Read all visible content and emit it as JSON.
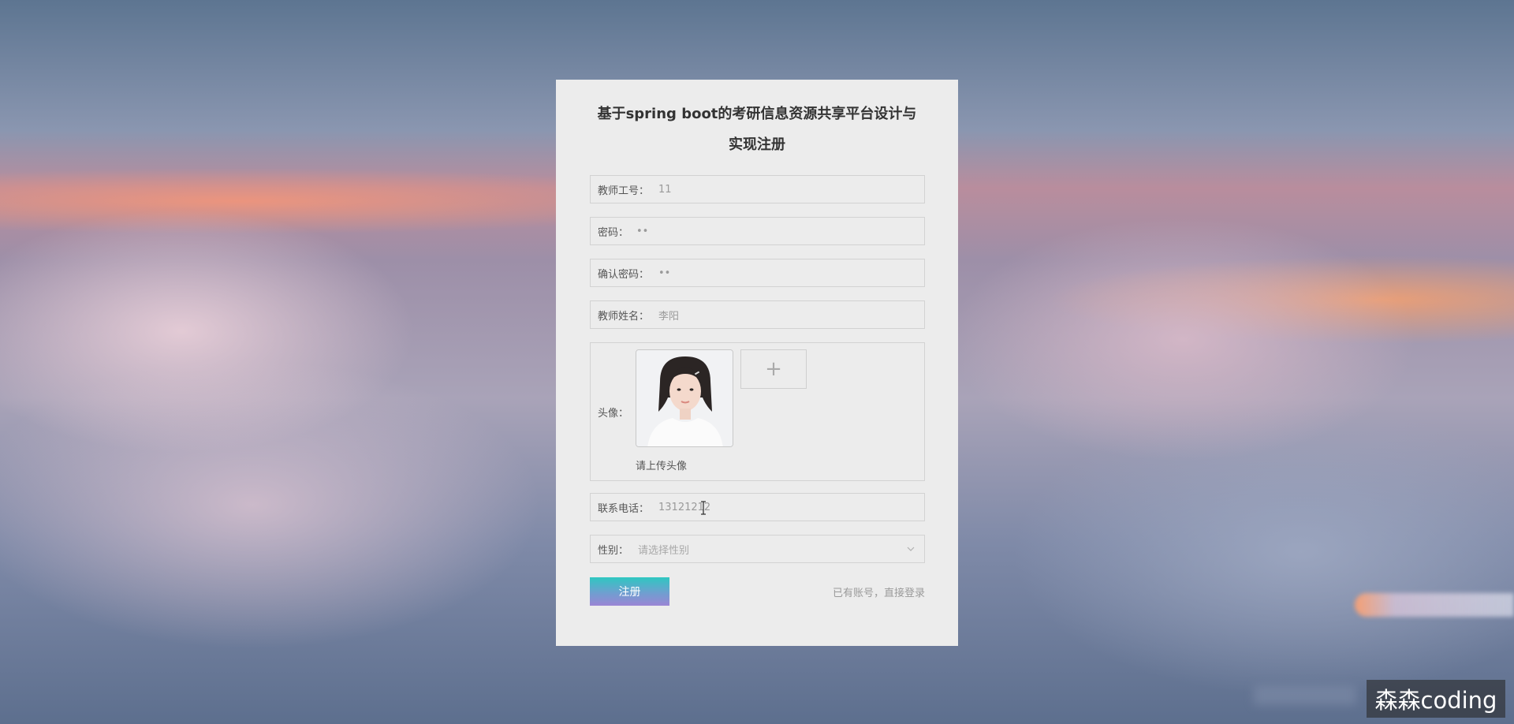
{
  "page": {
    "title_line1": "基于spring boot的考研信息资源共享平台设计与",
    "title_line2": "实现注册"
  },
  "form": {
    "teacher_id": {
      "label": "教师工号：",
      "value": "11"
    },
    "password": {
      "label": "密码：",
      "value": "••"
    },
    "confirm_password": {
      "label": "确认密码：",
      "value": "••"
    },
    "teacher_name": {
      "label": "教师姓名：",
      "value": "李阳"
    },
    "avatar": {
      "label": "头像：",
      "hint": "请上传头像",
      "upload_symbol": "+"
    },
    "phone": {
      "label": "联系电话：",
      "value": "13121212"
    },
    "gender": {
      "label": "性别：",
      "placeholder": "请选择性别"
    },
    "submit_label": "注册",
    "login_link": "已有账号，直接登录"
  },
  "watermark": "森森coding",
  "colors": {
    "card_bg": "#ececec",
    "button_gradient_start": "#2fc7c1",
    "button_gradient_end": "#9b85d4",
    "border": "#d2d2d2"
  },
  "icons": {
    "upload": "plus-icon",
    "gender_select": "chevron-down-icon",
    "text_cursor": "i-beam-cursor-icon"
  }
}
